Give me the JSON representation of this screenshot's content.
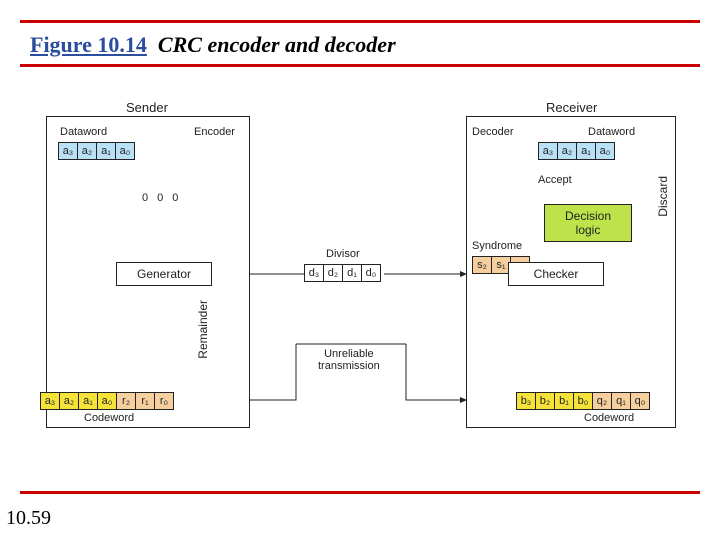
{
  "header": {
    "figure_label": "Figure 10.14",
    "caption": "CRC encoder and decoder"
  },
  "page_number": "10.59",
  "diagram": {
    "sender": {
      "title": "Sender",
      "dataword_label": "Dataword",
      "encoder_label": "Encoder",
      "generator_label": "Generator",
      "remainder_label": "Remainder",
      "codeword_label": "Codeword",
      "zeros": [
        "0",
        "0",
        "0"
      ],
      "dataword_bits": [
        "a₃",
        "a₂",
        "a₁",
        "a₀"
      ],
      "codeword_bits": [
        "a₃",
        "a₂",
        "a₁",
        "a₀",
        "r₂",
        "r₁",
        "r₀"
      ]
    },
    "divisor": {
      "label": "Divisor",
      "bits": [
        "d₃",
        "d₂",
        "d₁",
        "d₀"
      ]
    },
    "channel_label": "Unreliable\ntransmission",
    "receiver": {
      "title": "Receiver",
      "decoder_label": "Decoder",
      "dataword_label": "Dataword",
      "checker_label": "Checker",
      "syndrome_label": "Syndrome",
      "decision_label": "Decision\nlogic",
      "accept_label": "Accept",
      "discard_label": "Discard",
      "codeword_label": "Codeword",
      "dataword_bits": [
        "a₃",
        "a₂",
        "a₁",
        "a₀"
      ],
      "syndrome_bits": [
        "s₂",
        "s₁",
        "s₀"
      ],
      "codeword_bits": [
        "b₃",
        "b₂",
        "b₁",
        "b₀",
        "q₂",
        "q₁",
        "q₀"
      ]
    }
  }
}
